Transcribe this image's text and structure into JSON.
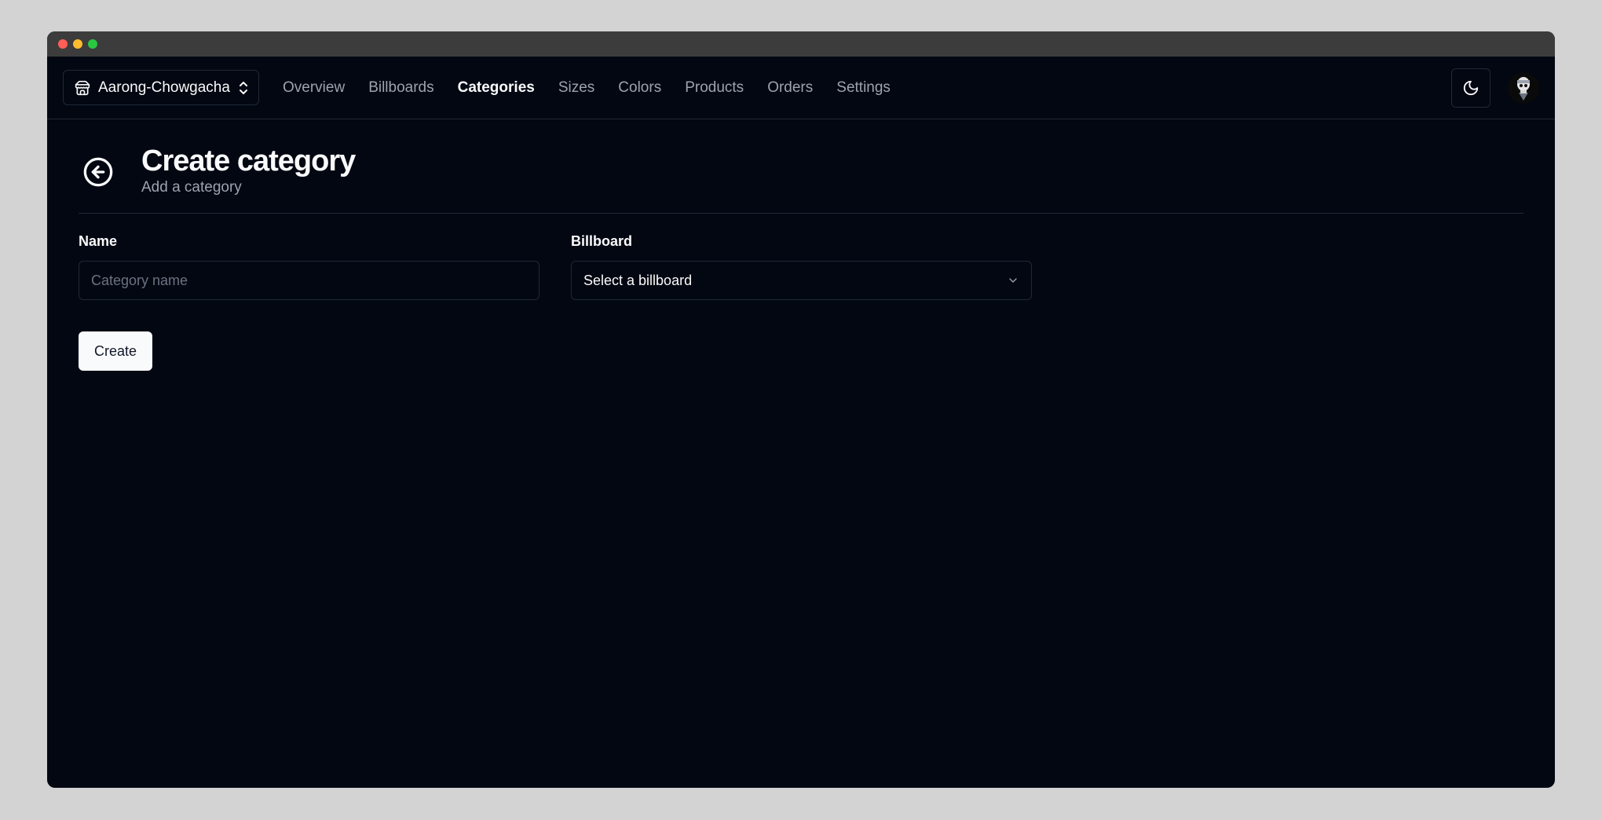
{
  "store_switcher": {
    "name": "Aarong-Chowgacha",
    "icon": "store-icon",
    "chevron_icon": "chevron-up-down-icon"
  },
  "nav": {
    "links": [
      {
        "label": "Overview",
        "active": false
      },
      {
        "label": "Billboards",
        "active": false
      },
      {
        "label": "Categories",
        "active": true
      },
      {
        "label": "Sizes",
        "active": false
      },
      {
        "label": "Colors",
        "active": false
      },
      {
        "label": "Products",
        "active": false
      },
      {
        "label": "Orders",
        "active": false
      },
      {
        "label": "Settings",
        "active": false
      }
    ],
    "theme_icon": "moon-icon",
    "avatar_icon": "user-avatar"
  },
  "page": {
    "title": "Create category",
    "subtitle": "Add a category",
    "back_icon": "arrow-left-circle-icon"
  },
  "form": {
    "name_label": "Name",
    "name_placeholder": "Category name",
    "name_value": "",
    "billboard_label": "Billboard",
    "billboard_value": "Select a billboard",
    "submit_label": "Create"
  },
  "colors": {
    "background": "#030712",
    "border": "#1f2937",
    "text": "#f9fafb",
    "muted": "#9ca3af",
    "primary_button": "#f9fafb"
  }
}
